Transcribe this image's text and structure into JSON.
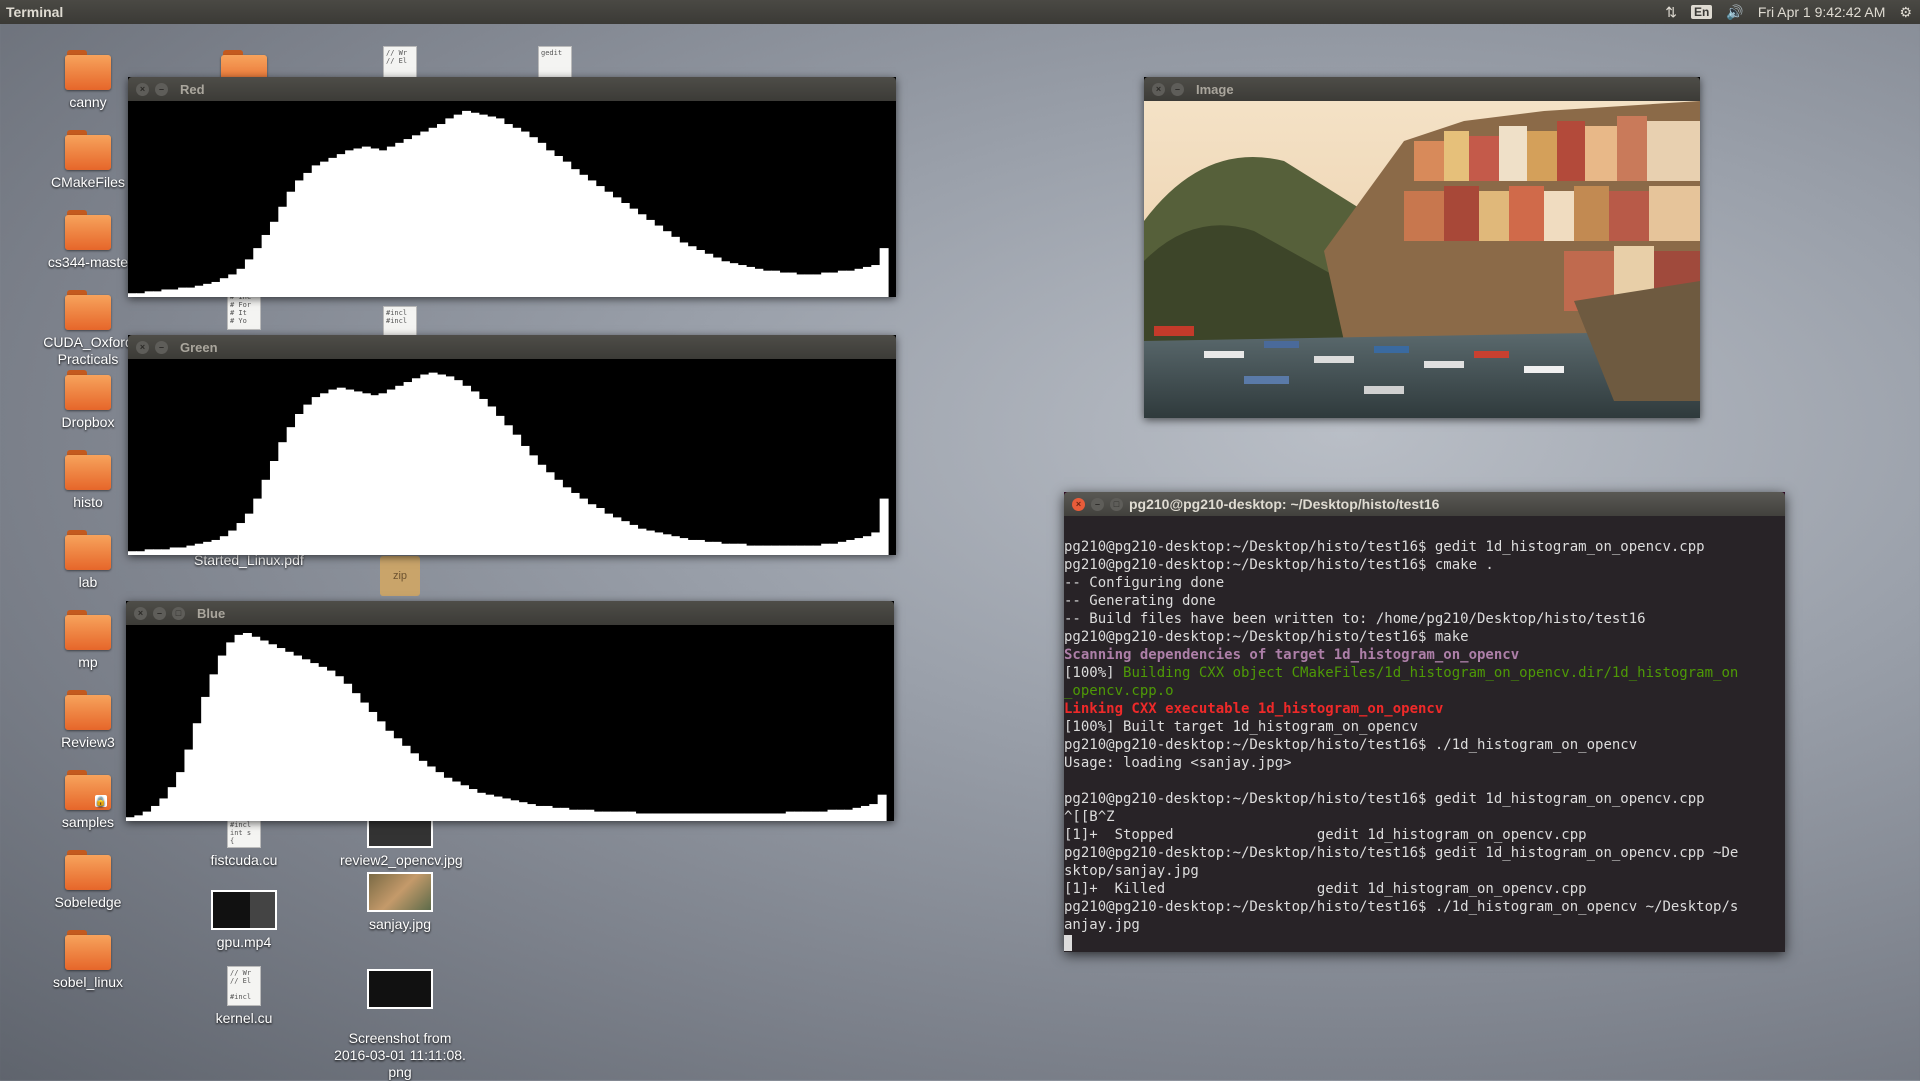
{
  "topbar": {
    "app_title": "Terminal",
    "lang": "En",
    "clock": "Fri Apr  1  9:42:42 AM",
    "icons": [
      "network-icon",
      "keyboard-icon",
      "volume-icon",
      "gear-icon"
    ]
  },
  "desktop": {
    "col1": [
      {
        "label": "canny",
        "type": "folder"
      },
      {
        "label": "CMakeFiles",
        "type": "folder"
      },
      {
        "label": "cs344-maste",
        "type": "folder"
      },
      {
        "label": "CUDA_Oxford\nPracticals",
        "type": "folder"
      },
      {
        "label": "Dropbox",
        "type": "folder"
      },
      {
        "label": "histo",
        "type": "folder"
      },
      {
        "label": "lab",
        "type": "folder"
      },
      {
        "label": "mp",
        "type": "folder"
      },
      {
        "label": "Review3",
        "type": "folder"
      },
      {
        "label": "samples",
        "type": "folder"
      },
      {
        "label": "Sobeledge",
        "type": "folder"
      },
      {
        "label": "sobel_linux",
        "type": "folder"
      }
    ],
    "col2": [
      {
        "label": "Started_Linux.pdf"
      },
      {
        "label": "fistcuda.cu"
      },
      {
        "label": "gpu.mp4"
      },
      {
        "label": "kernel.cu"
      }
    ],
    "col3": [
      {
        "label": "zip"
      },
      {
        "label": "review2_opencv.jpg"
      },
      {
        "label": "sanjay.jpg"
      },
      {
        "label": "Screenshot from\n2016-03-01 11:11:08.\npng"
      }
    ],
    "doc_snippets": {
      "d1": "// Wr\n// El",
      "d2": "gedit",
      "d3": "# inc\n# For\n# It\n# Yo",
      "d4": "#incl\n#incl",
      "d5": "#incl\nint s\n{",
      "d6": "// Wr\n// El\n\n#incl"
    }
  },
  "windows": {
    "red": {
      "title": "Red"
    },
    "green": {
      "title": "Green"
    },
    "blue": {
      "title": "Blue"
    },
    "image": {
      "title": "Image"
    },
    "terminal": {
      "title": "pg210@pg210-desktop: ~/Desktop/histo/test16"
    }
  },
  "terminal_lines": [
    {
      "text": "",
      "cls": ""
    },
    {
      "text": "pg210@pg210-desktop:~/Desktop/histo/test16$ gedit 1d_histogram_on_opencv.cpp",
      "cls": ""
    },
    {
      "text": "pg210@pg210-desktop:~/Desktop/histo/test16$ cmake .",
      "cls": ""
    },
    {
      "text": "-- Configuring done",
      "cls": ""
    },
    {
      "text": "-- Generating done",
      "cls": ""
    },
    {
      "text": "-- Build files have been written to: /home/pg210/Desktop/histo/test16",
      "cls": ""
    },
    {
      "text": "pg210@pg210-desktop:~/Desktop/histo/test16$ make",
      "cls": ""
    },
    {
      "text": "Scanning dependencies of target 1d_histogram_on_opencv",
      "cls": "c-magenta"
    },
    {
      "text": "[100%] ",
      "cls": "",
      "rest": "Building CXX object CMakeFiles/1d_histogram_on_opencv.dir/1d_histogram_on",
      "rest_cls": "c-green"
    },
    {
      "text": "_opencv.cpp.o",
      "cls": "c-green"
    },
    {
      "text": "Linking CXX executable 1d_histogram_on_opencv",
      "cls": "c-red"
    },
    {
      "text": "[100%] Built target 1d_histogram_on_opencv",
      "cls": ""
    },
    {
      "text": "pg210@pg210-desktop:~/Desktop/histo/test16$ ./1d_histogram_on_opencv",
      "cls": ""
    },
    {
      "text": "Usage: loading <sanjay.jpg>",
      "cls": ""
    },
    {
      "text": "",
      "cls": ""
    },
    {
      "text": "pg210@pg210-desktop:~/Desktop/histo/test16$ gedit 1d_histogram_on_opencv.cpp",
      "cls": ""
    },
    {
      "text": "^[[B^Z",
      "cls": ""
    },
    {
      "text": "[1]+  Stopped                 gedit 1d_histogram_on_opencv.cpp",
      "cls": ""
    },
    {
      "text": "pg210@pg210-desktop:~/Desktop/histo/test16$ gedit 1d_histogram_on_opencv.cpp ~De",
      "cls": ""
    },
    {
      "text": "sktop/sanjay.jpg",
      "cls": ""
    },
    {
      "text": "[1]+  Killed                  gedit 1d_histogram_on_opencv.cpp",
      "cls": ""
    },
    {
      "text": "pg210@pg210-desktop:~/Desktop/histo/test16$ ./1d_histogram_on_opencv ~/Desktop/s",
      "cls": ""
    },
    {
      "text": "anjay.jpg",
      "cls": ""
    }
  ],
  "histograms": {
    "red": [
      2,
      2,
      3,
      3,
      4,
      4,
      5,
      5,
      6,
      7,
      8,
      10,
      12,
      15,
      20,
      26,
      33,
      40,
      48,
      56,
      62,
      66,
      70,
      72,
      74,
      76,
      78,
      79,
      80,
      79,
      78,
      80,
      82,
      84,
      86,
      88,
      90,
      92,
      95,
      97,
      99,
      98,
      97,
      96,
      95,
      92,
      90,
      88,
      85,
      82,
      78,
      75,
      72,
      68,
      65,
      62,
      59,
      56,
      53,
      50,
      47,
      44,
      41,
      38,
      35,
      32,
      29,
      27,
      25,
      23,
      21,
      19,
      18,
      17,
      16,
      15,
      14,
      14,
      13,
      13,
      12,
      12,
      12,
      13,
      13,
      14,
      14,
      15,
      16,
      17,
      26
    ],
    "green": [
      2,
      2,
      3,
      3,
      3,
      4,
      4,
      5,
      6,
      7,
      8,
      10,
      13,
      17,
      22,
      30,
      40,
      50,
      60,
      68,
      75,
      80,
      84,
      86,
      88,
      89,
      88,
      87,
      86,
      85,
      86,
      88,
      90,
      92,
      94,
      96,
      97,
      96,
      95,
      93,
      90,
      87,
      83,
      79,
      74,
      69,
      64,
      58,
      53,
      48,
      44,
      40,
      36,
      33,
      30,
      27,
      25,
      22,
      20,
      18,
      16,
      14,
      13,
      12,
      11,
      10,
      9,
      8,
      8,
      7,
      7,
      6,
      6,
      6,
      5,
      5,
      5,
      5,
      5,
      5,
      5,
      5,
      5,
      6,
      6,
      7,
      8,
      9,
      10,
      12,
      30
    ],
    "blue": [
      2,
      3,
      5,
      8,
      12,
      18,
      26,
      38,
      52,
      66,
      78,
      88,
      95,
      99,
      100,
      98,
      96,
      94,
      92,
      90,
      88,
      86,
      84,
      82,
      80,
      77,
      73,
      68,
      63,
      58,
      53,
      48,
      44,
      40,
      36,
      32,
      29,
      26,
      23,
      21,
      19,
      17,
      15,
      14,
      13,
      12,
      11,
      10,
      9,
      8,
      8,
      7,
      7,
      6,
      6,
      6,
      5,
      5,
      5,
      5,
      5,
      4,
      4,
      4,
      4,
      4,
      4,
      4,
      4,
      4,
      4,
      4,
      4,
      4,
      4,
      4,
      4,
      4,
      4,
      5,
      5,
      5,
      5,
      5,
      6,
      6,
      6,
      7,
      8,
      9,
      14
    ]
  }
}
